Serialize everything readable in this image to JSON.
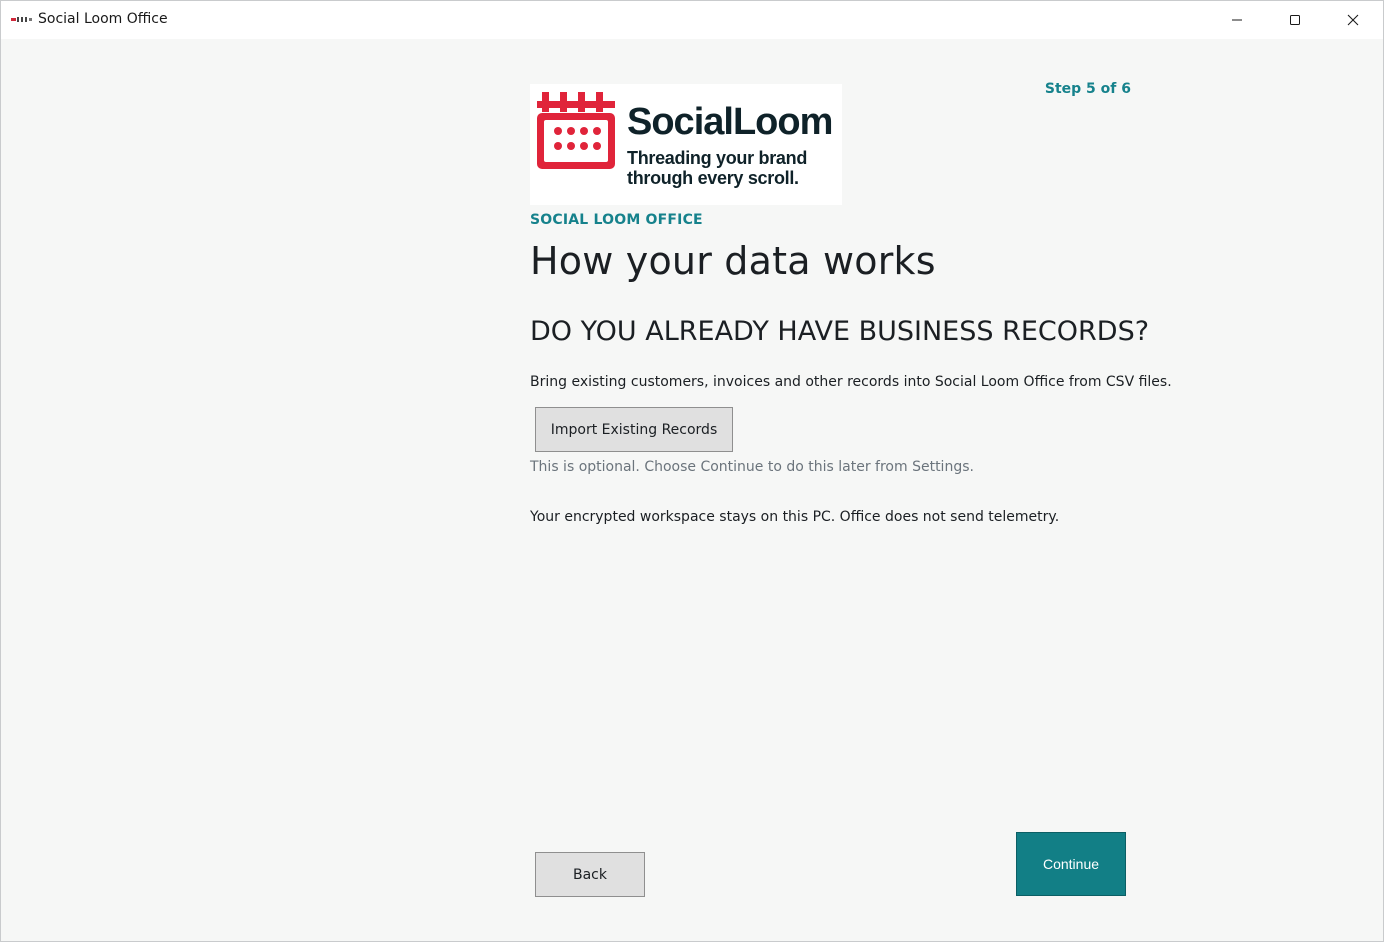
{
  "window": {
    "title": "Social Loom Office"
  },
  "logo": {
    "name": "SocialLoom",
    "tagline_line1": "Threading your brand",
    "tagline_line2": "through every scroll.",
    "icon": "loom-icon",
    "brand_color": "#e0243a"
  },
  "wizard": {
    "step": "Step 5 of 6",
    "brand_label": "SOCIAL LOOM OFFICE",
    "title": "How your data works",
    "section_heading": "DO YOU ALREADY HAVE BUSINESS RECORDS?",
    "description": "Bring existing customers, invoices and other records into Social Loom Office from CSV files.",
    "import_label": "Import Existing Records",
    "hint": "This is optional. Choose Continue to do this later from Settings.",
    "privacy_note": "Your encrypted workspace stays on this PC. Office does not send telemetry.",
    "back_label": "Back",
    "continue_label": "Continue"
  },
  "colors": {
    "accent": "#16828c",
    "primary_button": "#127f86"
  }
}
